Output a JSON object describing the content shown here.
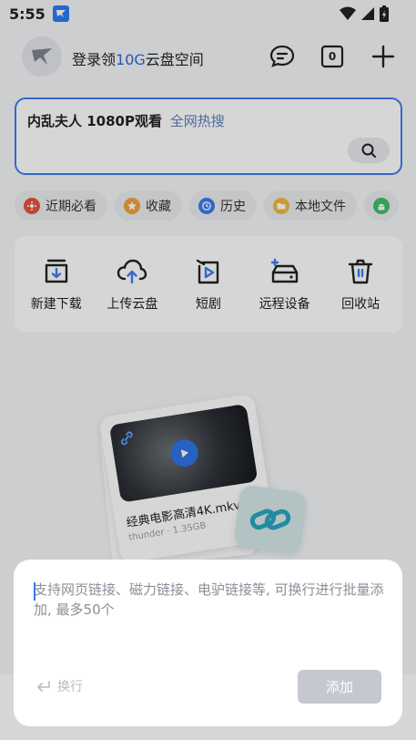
{
  "status_bar": {
    "time": "5:55"
  },
  "header": {
    "login_prefix": "登录领",
    "login_highlight": "10G",
    "login_suffix": "云盘空间",
    "counter_badge": "0"
  },
  "search": {
    "hot_term": "内乱夫人 1080P观看",
    "hot_tag": "全网热搜"
  },
  "chips": [
    {
      "label": "近期必看",
      "icon": "film-reel-icon",
      "color": "#e5533d"
    },
    {
      "label": "收藏",
      "icon": "star-icon",
      "color": "#f0a23a"
    },
    {
      "label": "历史",
      "icon": "clock-icon",
      "color": "#3a7cf0"
    },
    {
      "label": "本地文件",
      "icon": "folder-icon",
      "color": "#f0b840"
    },
    {
      "label": "",
      "icon": "android-icon",
      "color": "#3fbf6a"
    }
  ],
  "tools": [
    {
      "label": "新建下载",
      "icon": "download-box-icon"
    },
    {
      "label": "上传云盘",
      "icon": "cloud-upload-icon"
    },
    {
      "label": "短剧",
      "icon": "short-drama-icon"
    },
    {
      "label": "远程设备",
      "icon": "remote-device-icon"
    },
    {
      "label": "回收站",
      "icon": "trash-icon"
    }
  ],
  "illustration": {
    "file_name": "经典电影高清4K.mkv",
    "file_meta": "thunder · 1.35GB"
  },
  "sheet": {
    "placeholder": "支持网页链接、磁力链接、电驴链接等, 可换行进行批量添加, 最多50个",
    "value": "",
    "newline_label": "换行",
    "add_label": "添加"
  },
  "colors": {
    "accent": "#3d7cf0",
    "disabled_button": "#c5c8ce"
  }
}
